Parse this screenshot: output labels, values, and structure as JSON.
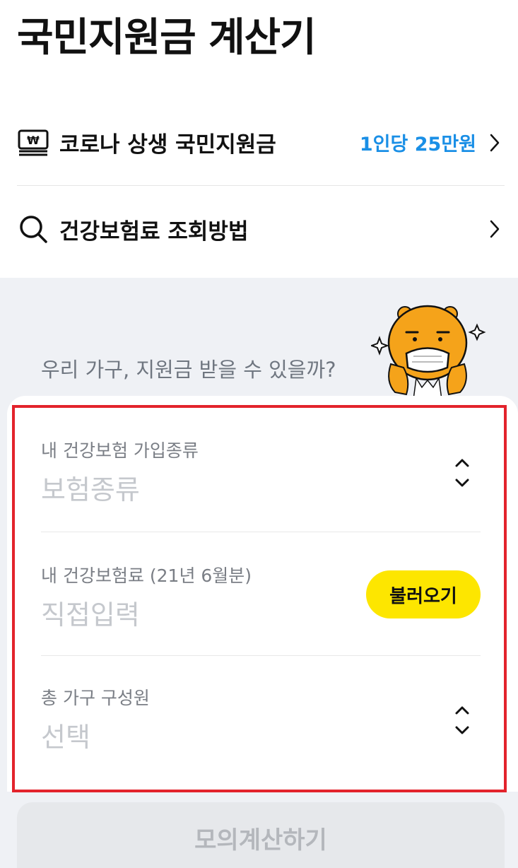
{
  "header": {
    "title": "국민지원금 계산기"
  },
  "menu": [
    {
      "icon": "won-banknote-icon",
      "label": "코로나 상생 국민지원금",
      "value": "1인당 25만원"
    },
    {
      "icon": "search-icon",
      "label": "건강보험료 조회방법",
      "value": ""
    }
  ],
  "intro": {
    "question": "우리 가구, 지원금 받을 수 있을까?"
  },
  "form": {
    "insurance_type": {
      "label": "내 건강보험 가입종류",
      "placeholder": "보험종류"
    },
    "premium": {
      "label": "내 건강보험료 (21년 6월분)",
      "placeholder": "직접입력",
      "load_button": "불러오기"
    },
    "household": {
      "label": "총 가구 구성원",
      "placeholder": "선택"
    }
  },
  "actions": {
    "calculate_label": "모의계산하기"
  },
  "colors": {
    "accent_blue": "#1a8fe6",
    "button_yellow": "#fde600",
    "highlight_red": "#e3232c",
    "section_grey": "#eff1f5"
  }
}
